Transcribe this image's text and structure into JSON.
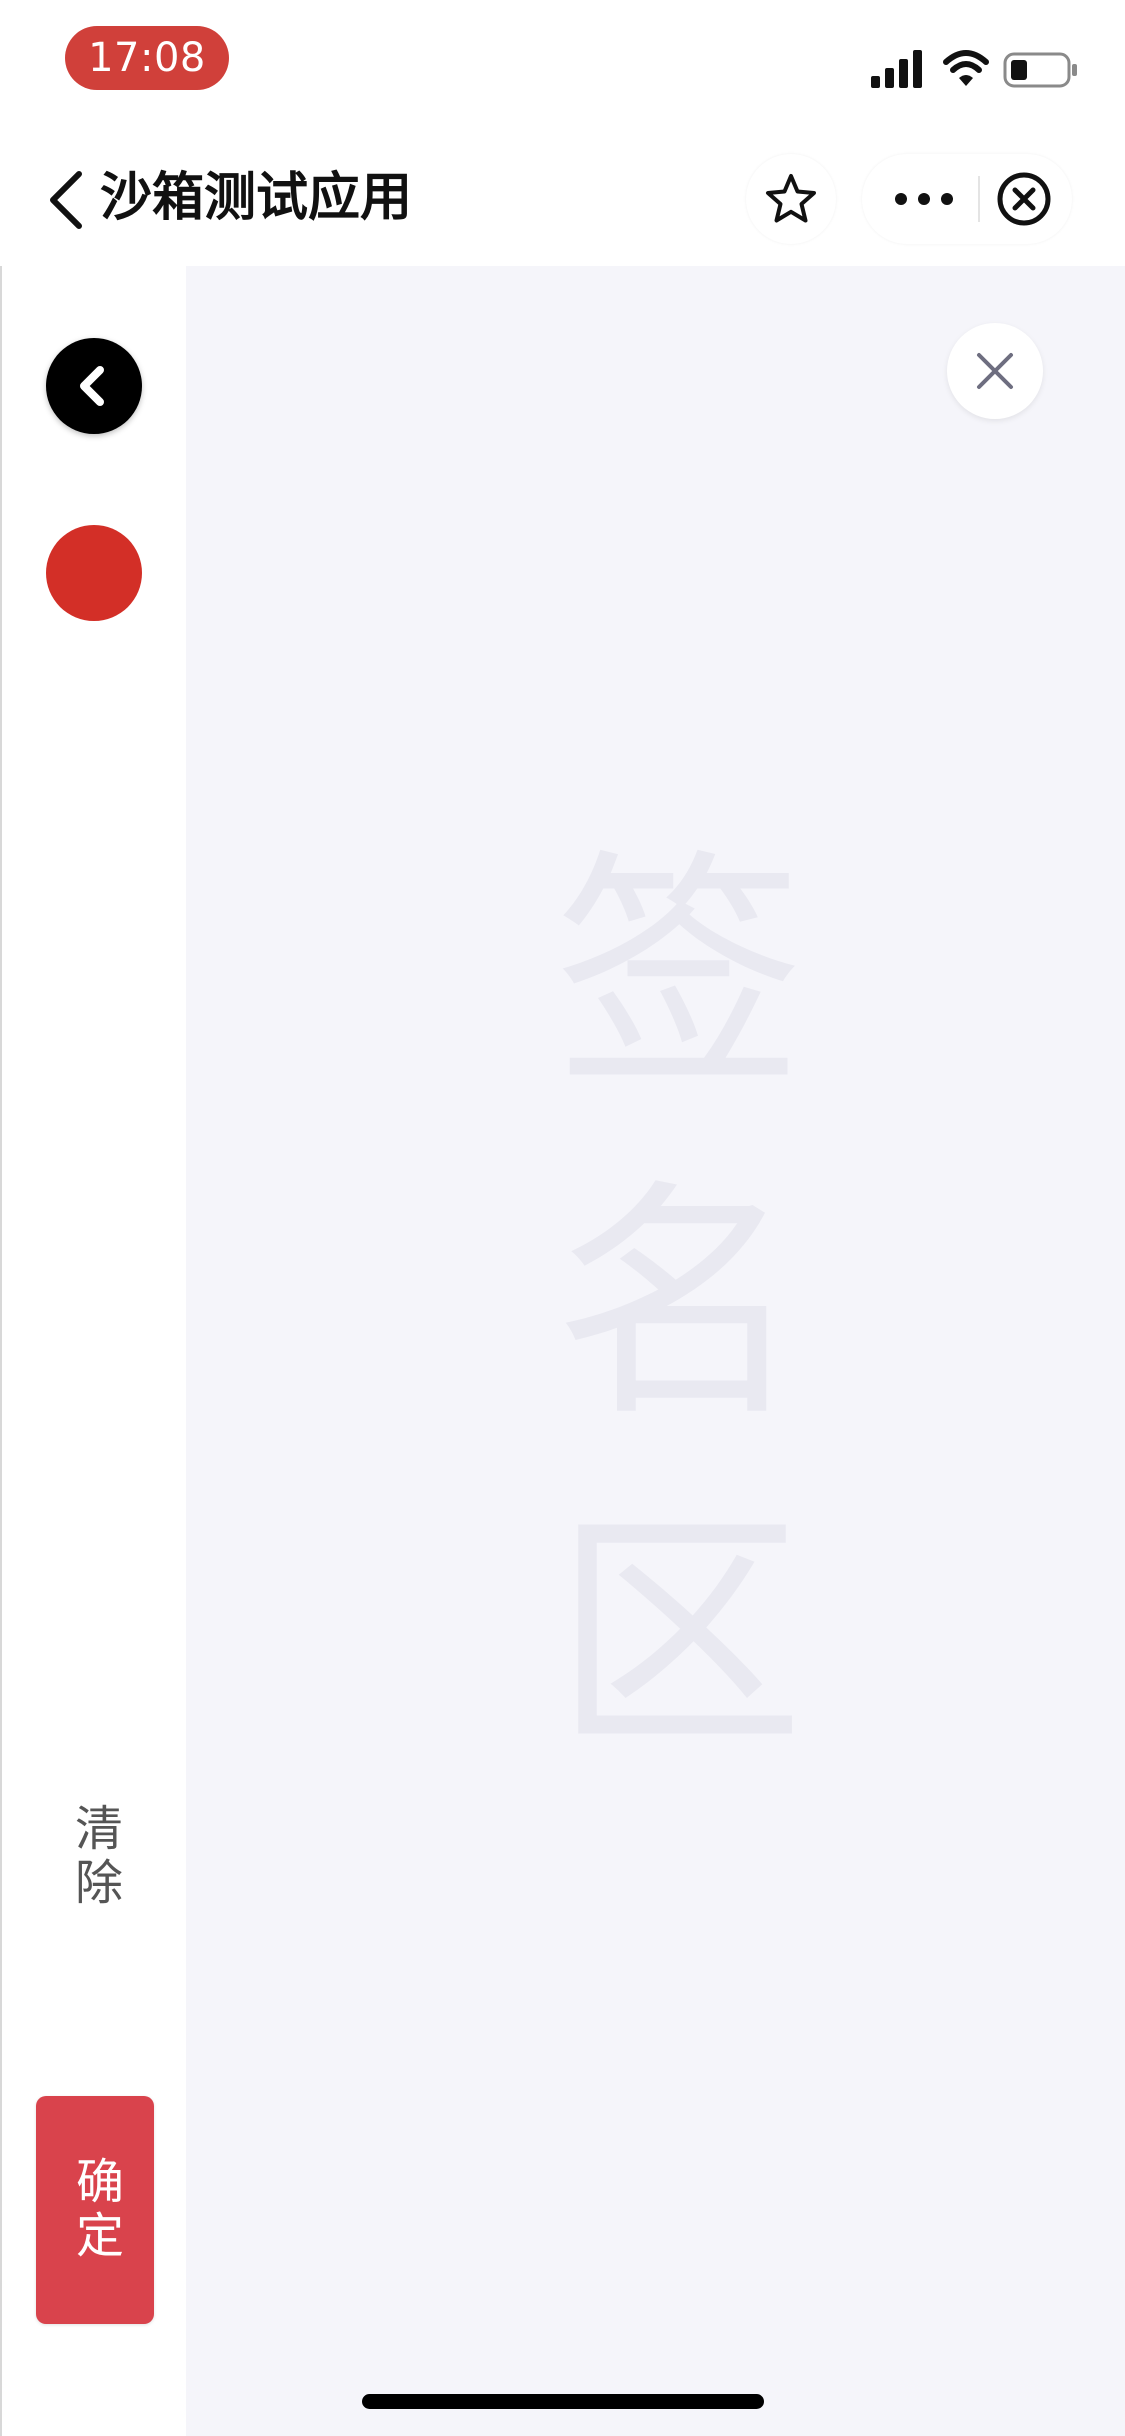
{
  "status_bar": {
    "time": "17:08",
    "icons": [
      "cellular-signal-icon",
      "wifi-icon",
      "battery-icon"
    ],
    "time_pill_color": "#d0403a"
  },
  "nav_bar": {
    "title": "沙箱测试应用",
    "icons": [
      "back-chevron-icon",
      "star-icon",
      "more-dots-icon",
      "close-circle-icon"
    ]
  },
  "toolbar": {
    "pen_color": "#d32f27",
    "clear_label": "清除",
    "confirm_label": "确定",
    "confirm_color": "#d9434c"
  },
  "canvas": {
    "watermark": "签名区",
    "background": "#f5f5fa"
  }
}
